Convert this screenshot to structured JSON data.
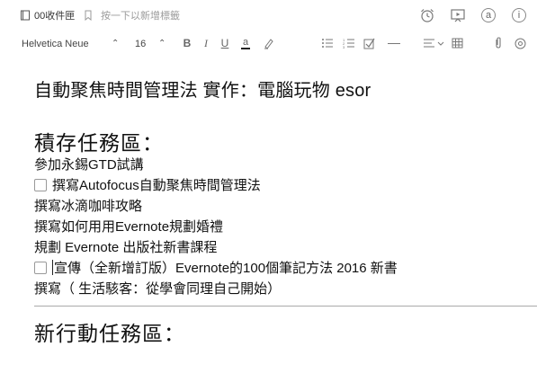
{
  "meta": {
    "notebook": "00收件匣",
    "tag_placeholder": "按一下以新增標籤"
  },
  "toolbar": {
    "font_family": "Helvetica Neue",
    "font_size": "16"
  },
  "note": {
    "title": "自動聚焦時間管理法 實作：電腦玩物 esor",
    "section1": "積存任務區：",
    "lines": [
      "參加永錫GTD試講",
      "撰寫Autofocus自動聚焦時間管理法",
      "撰寫冰滴咖啡攻略",
      "撰寫如何用用Evernote規劃婚禮",
      "規劃 Evernote 出版社新書課程",
      "宣傳（全新增訂版）Evernote的100個筆記方法 2016 新書",
      "撰寫（ 生活駭客：從學會同理自己開始）"
    ],
    "section2": "新行動任務區："
  }
}
